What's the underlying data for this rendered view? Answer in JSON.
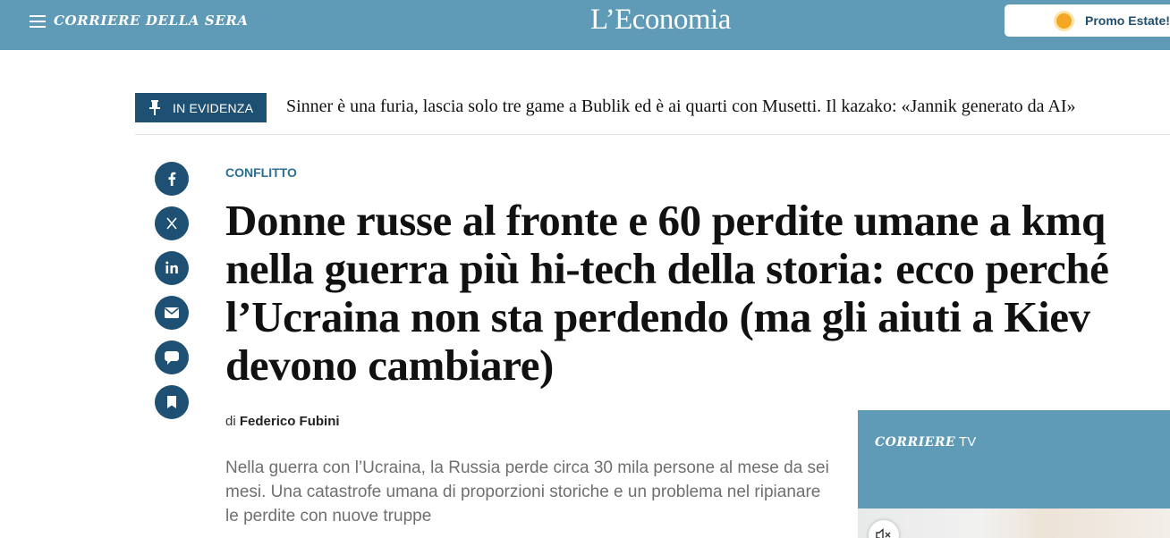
{
  "header": {
    "brand": "CORRIERE DELLA SERA",
    "logo": "L’Economia",
    "promo_label": "Promo Estate!",
    "menu_icon": "hamburger-menu-icon",
    "promo_icon": "sun-icon",
    "bar_color": "#5f9bb7"
  },
  "in_evidenza": {
    "label": "IN EVIDENZA",
    "icon": "pin-icon",
    "headline": "Sinner è una furia, lascia solo tre game a Bublik ed è ai quarti con Musetti. Il kazako: «Jannik generato da AI»",
    "color": "#1d5072"
  },
  "share": [
    {
      "icon": "facebook-icon"
    },
    {
      "icon": "x-icon"
    },
    {
      "icon": "linkedin-icon"
    },
    {
      "icon": "email-icon"
    },
    {
      "icon": "comment-icon"
    },
    {
      "icon": "bookmark-icon"
    }
  ],
  "article": {
    "section": "CONFLITTO",
    "title": "Donne russe al fronte e 60 perdite umane a kmq nella guerra più hi-tech della storia: ecco perché l’Ucraina non sta perdendo (ma gli aiuti a Kiev devono cambiare)",
    "byline_prefix": "di",
    "author": "Federico Fubini",
    "summary": "Nella guerra con l’Ucraina, la Russia perde circa 30 mila persone al mese da sei mesi. Una catastrofe umana di proporzioni storiche e un problema nel ripianare le perdite con nuove truppe"
  },
  "corriere_tv": {
    "brand": "CORRIERE",
    "suffix": "TV",
    "mute_icon": "speaker-muted-icon"
  }
}
